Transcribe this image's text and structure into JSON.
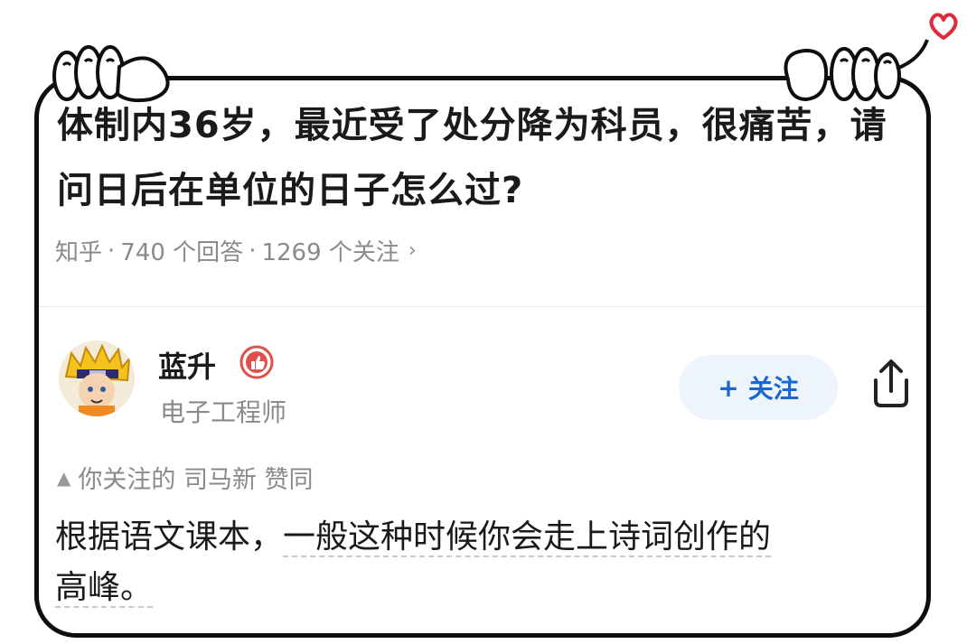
{
  "question": {
    "title": "体制内36岁，最近受了处分降为科员，很痛苦，请问日后在单位的日子怎么过?",
    "source": "知乎",
    "answers_count": "740 个回答",
    "followers_count": "1269 个关注",
    "separator": "·",
    "chevron": "›"
  },
  "answer": {
    "author_name": "蓝升",
    "author_description": "电子工程师",
    "badge_icon": "thumbs-up-badge",
    "follow_label": "关注",
    "follow_plus": "+",
    "liked_by": "你关注的 司马新 赞同",
    "liked_icon": "triangle-up",
    "text_part1": "根据语文课本，",
    "text_part2": "一般这种时候你会走上诗词创作的",
    "text_part3": "高峰。"
  },
  "colors": {
    "accent_blue": "#1a67d2",
    "follow_bg": "#eef4fb",
    "badge_red": "#e0504a",
    "heart_red": "#e0293a",
    "muted_text": "#8a8a8a"
  },
  "icons": [
    "share-icon",
    "heart-icon",
    "hand-icon",
    "badge-icon"
  ]
}
